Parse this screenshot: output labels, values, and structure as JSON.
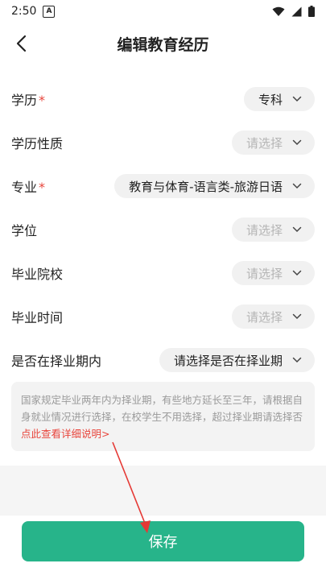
{
  "status": {
    "time": "2:50"
  },
  "header": {
    "title": "编辑教育经历"
  },
  "form": {
    "rows": [
      {
        "label": "学历",
        "required": true,
        "value": "专科",
        "is_placeholder": false
      },
      {
        "label": "学历性质",
        "required": false,
        "value": "请选择",
        "is_placeholder": true
      },
      {
        "label": "专业",
        "required": true,
        "value": "教育与体育-语言类-旅游日语",
        "is_placeholder": false
      },
      {
        "label": "学位",
        "required": false,
        "value": "请选择",
        "is_placeholder": true
      },
      {
        "label": "毕业院校",
        "required": false,
        "value": "请选择",
        "is_placeholder": true
      },
      {
        "label": "毕业时间",
        "required": false,
        "value": "请选择",
        "is_placeholder": true
      },
      {
        "label": "是否在择业期内",
        "required": false,
        "value": "请选择是否在择业期",
        "is_placeholder": false
      }
    ],
    "required_mark": "*"
  },
  "notice": {
    "text": "国家规定毕业两年内为择业期，有些地方延长至三年，请根据自身就业情况进行选择，在校学生不用选择，超过择业期请选择否",
    "link": "点此查看详细说明>"
  },
  "footer": {
    "save_label": "保存"
  },
  "colors": {
    "accent": "#27b48a",
    "required": "#e8453c",
    "annotation_arrow": "#e53935"
  }
}
